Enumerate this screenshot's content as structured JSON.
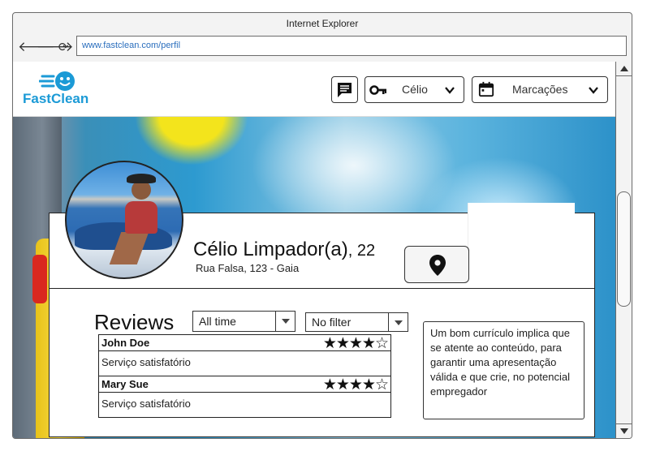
{
  "browser": {
    "title": "Internet Explorer",
    "url": "www.fastclean.com/perfil"
  },
  "header": {
    "logo_text": "FastClean",
    "user_menu": {
      "label": "Célio",
      "icon": "key-icon"
    },
    "appointments_menu": {
      "label": "Marcações",
      "icon": "calendar-icon"
    },
    "messages_icon": "chat-icon"
  },
  "profile": {
    "name": "Célio Limpador(a)",
    "age": ", 22",
    "address": "Rua Falsa, 123 - Gaia"
  },
  "reviews": {
    "title": "Reviews",
    "time_filter": "All time",
    "rating_filter": "No filter",
    "items": [
      {
        "author": "John Doe",
        "stars": "★★★★☆",
        "rating": 4,
        "text": "Serviço satisfatório"
      },
      {
        "author": "Mary Sue",
        "stars": "★★★★☆",
        "rating": 4,
        "text": "Serviço satisfatório"
      }
    ]
  },
  "note": {
    "text": "Um bom currículo implica que se atente ao conteúdo, para garantir uma apresentação válida e que crie, no potencial empregador"
  },
  "colors": {
    "brand": "#1b9ad6",
    "url": "#2a6ebd"
  }
}
